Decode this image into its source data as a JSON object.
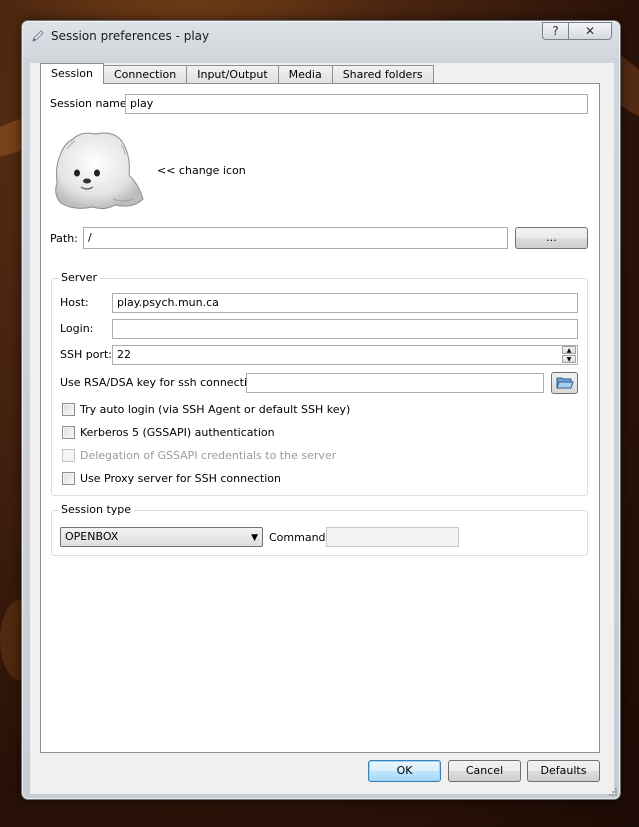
{
  "window": {
    "title": "Session preferences - play",
    "help_glyph": "?",
    "close_glyph": "✕"
  },
  "tabs": [
    {
      "label": "Session",
      "active": true
    },
    {
      "label": "Connection",
      "active": false
    },
    {
      "label": "Input/Output",
      "active": false
    },
    {
      "label": "Media",
      "active": false
    },
    {
      "label": "Shared folders",
      "active": false
    }
  ],
  "session": {
    "name_label": "Session name:",
    "name_value": "play",
    "change_icon_label": "<< change icon",
    "path_label": "Path:",
    "path_value": "/",
    "browse_label": "..."
  },
  "server": {
    "group_title": "Server",
    "host_label": "Host:",
    "host_value": "play.psych.mun.ca",
    "login_label": "Login:",
    "login_value": "",
    "ssh_port_label": "SSH port:",
    "ssh_port_value": "22",
    "rsa_label": "Use RSA/DSA key for ssh connection:",
    "rsa_value": "",
    "options": [
      {
        "label": "Try auto login (via SSH Agent or default SSH key)",
        "checked": false,
        "enabled": true
      },
      {
        "label": "Kerberos 5 (GSSAPI) authentication",
        "checked": false,
        "enabled": true
      },
      {
        "label": "Delegation of GSSAPI credentials to the server",
        "checked": false,
        "enabled": false
      },
      {
        "label": "Use Proxy server for SSH connection",
        "checked": false,
        "enabled": true
      }
    ]
  },
  "session_type": {
    "group_title": "Session type",
    "selected": "OPENBOX",
    "command_label": "Command:",
    "command_value": ""
  },
  "buttons": {
    "ok": "OK",
    "cancel": "Cancel",
    "defaults": "Defaults"
  },
  "icons": {
    "title": "pencil-icon",
    "session": "seal-mascot-icon",
    "folder": "open-folder-icon"
  },
  "colors": {
    "desktop": "#3a1a0a",
    "accent_button": "#3c7fb1"
  }
}
